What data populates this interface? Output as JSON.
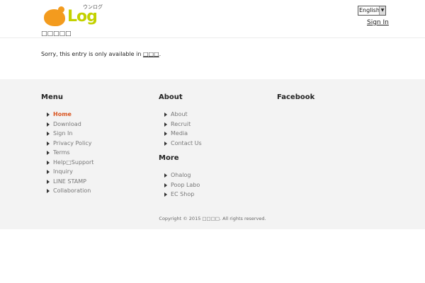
{
  "header": {
    "logo_text": "Log",
    "logo_kana": "ウンログ",
    "tagline": "□□□□□",
    "language_select": "English",
    "signin_label": "Sign In"
  },
  "main": {
    "notice_text": "Sorry, this entry is only available in ",
    "notice_language": "□□□",
    "notice_end": "."
  },
  "footer": {
    "menu": {
      "title": "Menu",
      "items": [
        "Home",
        "Download",
        "Sign In",
        "Privacy Policy",
        "Terms",
        "Help□Support",
        "Inquiry",
        "LINE STAMP",
        "Collaboration"
      ]
    },
    "about": {
      "title": "About",
      "items": [
        "About",
        "Recruit",
        "Media",
        "Contact Us"
      ]
    },
    "more": {
      "title": "More",
      "items": [
        "Ohalog",
        "Poop Labo",
        "EC Shop"
      ]
    },
    "facebook": {
      "title": "Facebook"
    },
    "copyright": "Copyright © 2015 □□□□. All rights reserved."
  },
  "colors": {
    "accent_active": "#d9531e",
    "logo_orange": "#f39b1e",
    "logo_green": "#c3d100",
    "footer_bg": "#f3f3f3"
  }
}
